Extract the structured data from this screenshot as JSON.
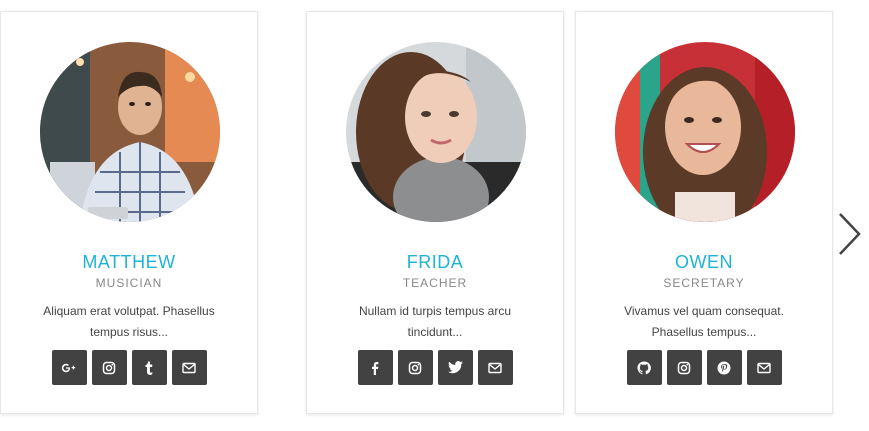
{
  "team": [
    {
      "name": "FRIDA",
      "role": "TEACHER",
      "description": "Nullam id turpis tempus arcu tincidunt...",
      "socials": [
        "facebook-icon",
        "instagram-icon",
        "twitter-icon",
        "email-icon"
      ]
    },
    {
      "name": "OWEN",
      "role": "SECRETARY",
      "description": "Vivamus vel quam consequat. Phasellus tempus...",
      "socials": [
        "github-icon",
        "instagram-icon",
        "pinterest-icon",
        "email-icon"
      ]
    },
    {
      "name": "MATTHEW",
      "role": "MUSICIAN",
      "description": "Aliquam erat volutpat. Phasellus tempus risus...",
      "socials": [
        "google-plus-icon",
        "instagram-icon",
        "tumblr-icon",
        "email-icon"
      ]
    }
  ],
  "colors": {
    "accent": "#1fb3d8",
    "icon_bg": "#424242",
    "role_text": "#888888",
    "arrow_prev": "#b5b5b5",
    "arrow_next": "#444444"
  }
}
